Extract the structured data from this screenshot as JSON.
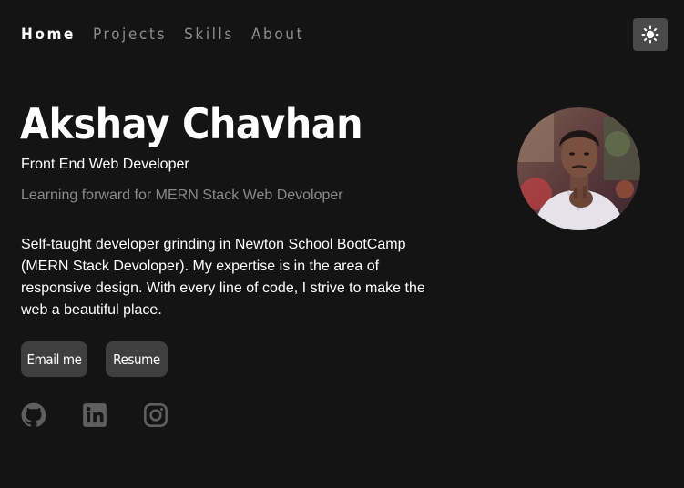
{
  "nav": {
    "items": [
      {
        "label": "Home",
        "active": true
      },
      {
        "label": "Projects",
        "active": false
      },
      {
        "label": "Skills",
        "active": false
      },
      {
        "label": "About",
        "active": false
      }
    ],
    "theme_toggle_icon": "sun-icon"
  },
  "hero": {
    "name": "Akshay Chavhan",
    "role": "Front End Web Developer",
    "tagline": "Learning forward for MERN Stack Web Devoloper",
    "bio": "Self-taught developer grinding in Newton School BootCamp (MERN Stack Devoloper). My expertise is in the area of responsive design. With every line of code, I strive to make the web a beautiful place.",
    "buttons": {
      "email_label": "Email me",
      "resume_label": "Resume"
    },
    "social": [
      "github-icon",
      "linkedin-icon",
      "instagram-icon"
    ],
    "avatar": "profile-photo"
  },
  "colors": {
    "background": "#141414",
    "button_bg": "#3f3f3f",
    "muted_text": "#8a8a8a",
    "icon_gray": "#5f5f5f"
  }
}
